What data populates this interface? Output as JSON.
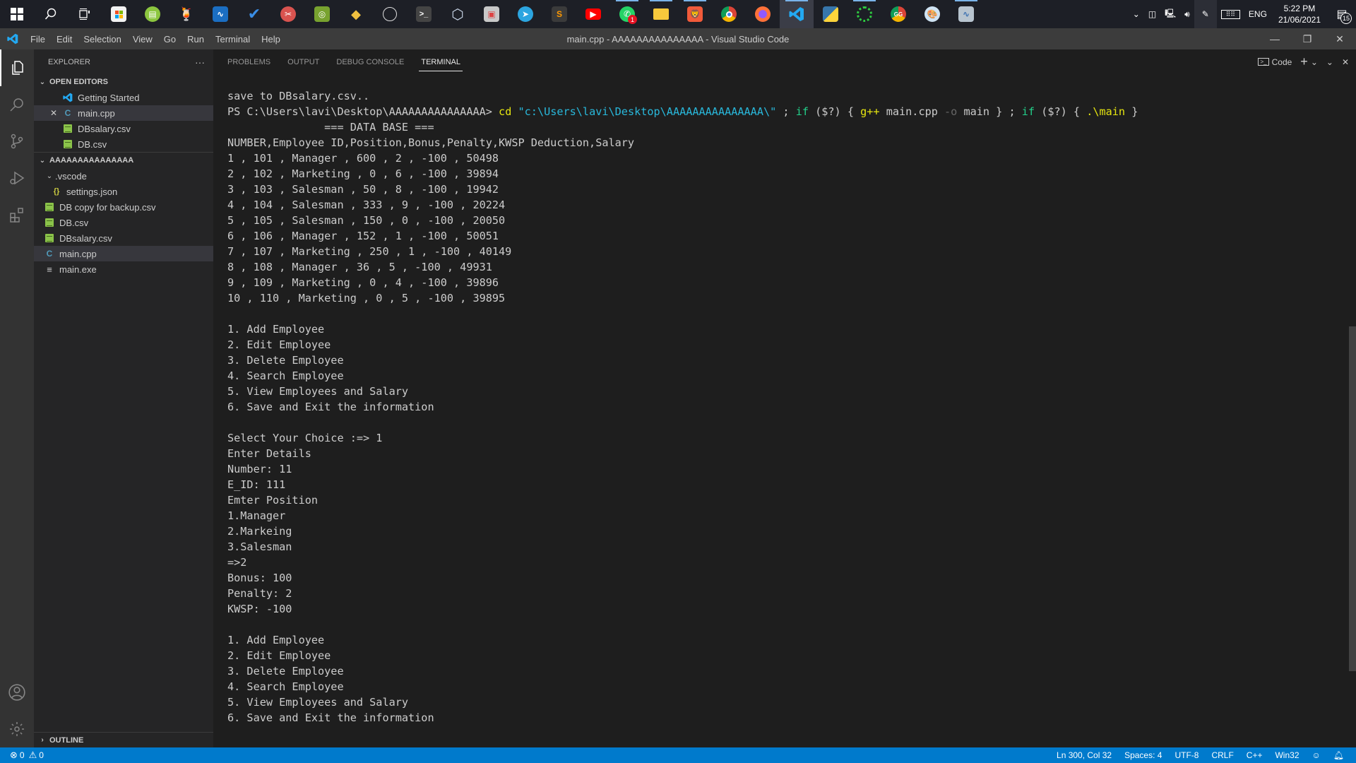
{
  "taskbar": {
    "apps": [
      {
        "name": "start",
        "icon": "windows-icon"
      },
      {
        "name": "search",
        "icon": "search-icon"
      },
      {
        "name": "task-view",
        "icon": "task-view-icon"
      },
      {
        "name": "microsoft-store",
        "icon": "store-icon"
      },
      {
        "name": "app-green",
        "icon": "green-app-icon"
      },
      {
        "name": "app-fruit",
        "icon": "fruit-app-icon"
      },
      {
        "name": "whiteboard",
        "icon": "whiteboard-icon"
      },
      {
        "name": "todo",
        "icon": "checkmark-icon"
      },
      {
        "name": "snip-tool",
        "icon": "scissors-icon"
      },
      {
        "name": "android-app",
        "icon": "android-icon"
      },
      {
        "name": "git-app",
        "icon": "git-diamond-icon"
      },
      {
        "name": "obs",
        "icon": "obs-icon"
      },
      {
        "name": "terminal",
        "icon": "terminal-icon"
      },
      {
        "name": "virtualbox",
        "icon": "cube-icon"
      },
      {
        "name": "remote-app",
        "icon": "window-stack-icon"
      },
      {
        "name": "telegram",
        "icon": "telegram-icon"
      },
      {
        "name": "sublime",
        "icon": "sublime-icon"
      },
      {
        "name": "youtube",
        "icon": "youtube-icon"
      },
      {
        "name": "whatsapp",
        "icon": "whatsapp-icon",
        "badge": "1"
      },
      {
        "name": "file-explorer",
        "icon": "folder-icon"
      },
      {
        "name": "brave",
        "icon": "brave-icon"
      },
      {
        "name": "chrome",
        "icon": "chrome-icon"
      },
      {
        "name": "firefox",
        "icon": "firefox-icon"
      },
      {
        "name": "vscode",
        "icon": "vscode-icon"
      },
      {
        "name": "python",
        "icon": "python-icon"
      },
      {
        "name": "loader-app",
        "icon": "ring-icon"
      },
      {
        "name": "chrome-profile",
        "icon": "chrome-gg-icon"
      },
      {
        "name": "paint",
        "icon": "paint-icon"
      },
      {
        "name": "resource-monitor",
        "icon": "monitor-icon"
      }
    ],
    "tray": {
      "language": "ENG",
      "time": "5:22 PM",
      "date": "21/06/2021",
      "notification_count": "15"
    }
  },
  "titlebar": {
    "menu": [
      "File",
      "Edit",
      "Selection",
      "View",
      "Go",
      "Run",
      "Terminal",
      "Help"
    ],
    "title": "main.cpp - AAAAAAAAAAAAAAA - Visual Studio Code"
  },
  "sidebar": {
    "header": "EXPLORER",
    "more_label": "···",
    "open_editors": {
      "label": "OPEN EDITORS",
      "items": [
        {
          "label": "Getting Started",
          "type": "vscode"
        },
        {
          "label": "main.cpp",
          "type": "cpp"
        },
        {
          "label": "DBsalary.csv",
          "type": "csv"
        },
        {
          "label": "DB.csv",
          "type": "csv"
        }
      ]
    },
    "workspace": {
      "label": "AAAAAAAAAAAAAAA",
      "folder": ".vscode",
      "folder_items": [
        {
          "label": "settings.json",
          "type": "json"
        }
      ],
      "items": [
        {
          "label": "DB copy for backup.csv",
          "type": "csv"
        },
        {
          "label": "DB.csv",
          "type": "csv"
        },
        {
          "label": "DBsalary.csv",
          "type": "csv"
        },
        {
          "label": "main.cpp",
          "type": "cpp"
        },
        {
          "label": "main.exe",
          "type": "exe"
        }
      ]
    },
    "outline_label": "OUTLINE"
  },
  "panel": {
    "tabs": [
      "PROBLEMS",
      "OUTPUT",
      "DEBUG CONSOLE",
      "TERMINAL"
    ],
    "active_tab": "TERMINAL",
    "terminal_name": "Code",
    "terminal": {
      "line_save": "save to DBsalary.csv..",
      "prompt": "PS C:\\Users\\lavi\\Desktop\\AAAAAAAAAAAAAAA> ",
      "cmd_cd": "cd",
      "cmd_path": "\"c:\\Users\\lavi\\Desktop\\AAAAAAAAAAAAAAA\\\"",
      "cmd_sep1": " ; ",
      "cmd_if1": "if",
      "cmd_cond1": " ($?) { ",
      "cmd_gpp": "g++",
      "cmd_main_cpp": " main.cpp ",
      "cmd_o": "-o",
      "cmd_main_close": " main } ; ",
      "cmd_if2": "if",
      "cmd_cond2": " ($?) { ",
      "cmd_run": ".\\main",
      "cmd_close": " }",
      "db_title": "               === DATA BASE ===",
      "db_header": "NUMBER,Employee ID,Position,Bonus,Penalty,KWSP Deduction,Salary",
      "db_rows": [
        "1 , 101 , Manager , 600 , 2 , -100 , 50498",
        "2 , 102 , Marketing , 0 , 6 , -100 , 39894",
        "3 , 103 , Salesman , 50 , 8 , -100 , 19942",
        "4 , 104 , Salesman , 333 , 9 , -100 , 20224",
        "5 , 105 , Salesman , 150 , 0 , -100 , 20050",
        "6 , 106 , Manager , 152 , 1 , -100 , 50051",
        "7 , 107 , Marketing , 250 , 1 , -100 , 40149",
        "8 , 108 , Manager , 36 , 5 , -100 , 49931",
        "9 , 109 , Marketing , 0 , 4 , -100 , 39896",
        "10 , 110 , Marketing , 0 , 5 , -100 , 39895"
      ],
      "menu": [
        "1. Add Employee",
        "2. Edit Employee",
        "3. Delete Employee",
        "4. Search Employee",
        "5. View Employees and Salary",
        "6. Save and Exit the information"
      ],
      "session": [
        "Select Your Choice :=> 1",
        "Enter Details",
        "Number: 11",
        "E_ID: 111",
        "Emter Position",
        "1.Manager",
        "2.Markeing",
        "3.Salesman",
        "=>2",
        "Bonus: 100",
        "Penalty: 2",
        "KWSP: -100"
      ]
    }
  },
  "statusbar": {
    "errors": "0",
    "warnings": "0",
    "position": "Ln 300, Col 32",
    "spaces": "Spaces: 4",
    "encoding": "UTF-8",
    "eol": "CRLF",
    "language": "C++",
    "platform": "Win32"
  }
}
